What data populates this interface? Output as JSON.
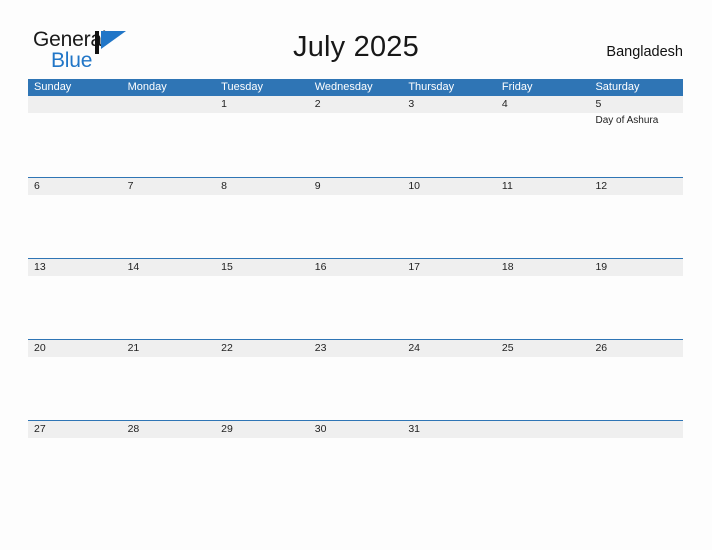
{
  "brand": {
    "name_part1": "General",
    "name_part2": "Blue",
    "flag_icon": "blue-flag-triangle-icon"
  },
  "header": {
    "title": "July 2025",
    "country": "Bangladesh"
  },
  "calendar": {
    "weekday_headers": [
      "Sunday",
      "Monday",
      "Tuesday",
      "Wednesday",
      "Thursday",
      "Friday",
      "Saturday"
    ],
    "colors": {
      "header_blue": "#2f75b5",
      "row_band_grey": "#efefef",
      "page_background": "#fdfdfd",
      "brand_blue": "#2176c7"
    },
    "weeks": [
      {
        "days": [
          {
            "number": "",
            "event": ""
          },
          {
            "number": "",
            "event": ""
          },
          {
            "number": "1",
            "event": ""
          },
          {
            "number": "2",
            "event": ""
          },
          {
            "number": "3",
            "event": ""
          },
          {
            "number": "4",
            "event": ""
          },
          {
            "number": "5",
            "event": "Day of Ashura"
          }
        ]
      },
      {
        "days": [
          {
            "number": "6",
            "event": ""
          },
          {
            "number": "7",
            "event": ""
          },
          {
            "number": "8",
            "event": ""
          },
          {
            "number": "9",
            "event": ""
          },
          {
            "number": "10",
            "event": ""
          },
          {
            "number": "11",
            "event": ""
          },
          {
            "number": "12",
            "event": ""
          }
        ]
      },
      {
        "days": [
          {
            "number": "13",
            "event": ""
          },
          {
            "number": "14",
            "event": ""
          },
          {
            "number": "15",
            "event": ""
          },
          {
            "number": "16",
            "event": ""
          },
          {
            "number": "17",
            "event": ""
          },
          {
            "number": "18",
            "event": ""
          },
          {
            "number": "19",
            "event": ""
          }
        ]
      },
      {
        "days": [
          {
            "number": "20",
            "event": ""
          },
          {
            "number": "21",
            "event": ""
          },
          {
            "number": "22",
            "event": ""
          },
          {
            "number": "23",
            "event": ""
          },
          {
            "number": "24",
            "event": ""
          },
          {
            "number": "25",
            "event": ""
          },
          {
            "number": "26",
            "event": ""
          }
        ]
      },
      {
        "days": [
          {
            "number": "27",
            "event": ""
          },
          {
            "number": "28",
            "event": ""
          },
          {
            "number": "29",
            "event": ""
          },
          {
            "number": "30",
            "event": ""
          },
          {
            "number": "31",
            "event": ""
          },
          {
            "number": "",
            "event": ""
          },
          {
            "number": "",
            "event": ""
          }
        ]
      }
    ]
  }
}
